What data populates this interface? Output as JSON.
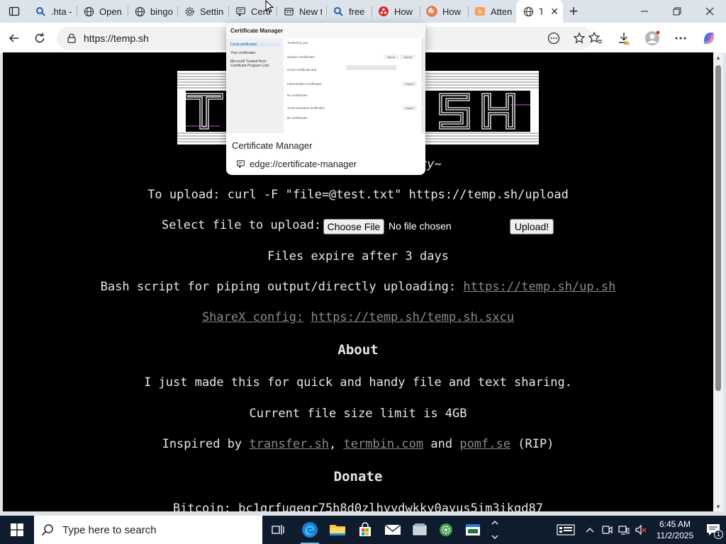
{
  "browser": {
    "tabs": [
      {
        "title": ".hta - S",
        "icon": "search-icon"
      },
      {
        "title": "Open",
        "icon": "globe-icon"
      },
      {
        "title": "bingo",
        "icon": "globe-icon"
      },
      {
        "title": "Setting",
        "icon": "gear-icon"
      },
      {
        "title": "Certi",
        "icon": "certificate-icon"
      },
      {
        "title": "New ta",
        "icon": "new-tab-icon"
      },
      {
        "title": "free rc",
        "icon": "search-icon"
      },
      {
        "title": "How T",
        "icon": "app-icon"
      },
      {
        "title": "How t",
        "icon": "app-icon"
      },
      {
        "title": "Attent",
        "icon": "app-icon"
      },
      {
        "title": "Te",
        "icon": "globe-icon"
      }
    ],
    "address": "https://temp.sh"
  },
  "tab_preview": {
    "window_title": "Certificate Manager",
    "sidebar": [
      "Local certificates",
      "Your certificates",
      "Microsoft Trusted Root Certificate Program Lists"
    ],
    "rows": [
      "Trusted by you",
      "System Certificates",
      "Hover certificate and",
      "Intermediate Certificates",
      "No certificates",
      "Trust untrusted certificates",
      "No certificates"
    ],
    "buttons": [
      "Import",
      "Export",
      "Import",
      "Import"
    ],
    "name": "Certificate Manager",
    "url": "edge://certificate-manager"
  },
  "page": {
    "tagline": "ry~",
    "curl_line": "To upload: curl -F \"file=@test.txt\" https://temp.sh/upload",
    "select_label": "Select file to upload:",
    "choose_file": "Choose File",
    "no_file": "No file chosen",
    "upload_btn": "Upload!",
    "expire": "Files expire after 3 days",
    "bash_prefix": "Bash script for piping output/directly uploading:",
    "bash_link": "https://temp.sh/up.sh",
    "sharex_label": "ShareX config:",
    "sharex_link": "https://temp.sh/temp.sh.sxcu",
    "about_heading": "About",
    "about_text": "I just made this for quick and handy file and text sharing.",
    "limit_text": "Current file size limit is 4GB",
    "inspired_prefix": "Inspired by",
    "inspired_link1": "transfer.sh",
    "inspired_sep1": ",",
    "inspired_link2": "termbin.com",
    "inspired_and": "and",
    "inspired_link3": "pomf.se",
    "inspired_suffix": "(RIP)",
    "donate_heading": "Donate",
    "bitcoin_line": "Bitcoin: bc1qrfugegr75h8d0zlhyydwkky0ayus5im3ikgd87"
  },
  "taskbar": {
    "search_placeholder": "Type here to search",
    "time": "6:45 AM",
    "date": "11/2/2025",
    "notification_count": "1"
  },
  "colors": {
    "page_bg": "#000000",
    "text": "#e8e8e8",
    "link": "#8a8a8a",
    "taskbar": "#0f1c2e"
  }
}
